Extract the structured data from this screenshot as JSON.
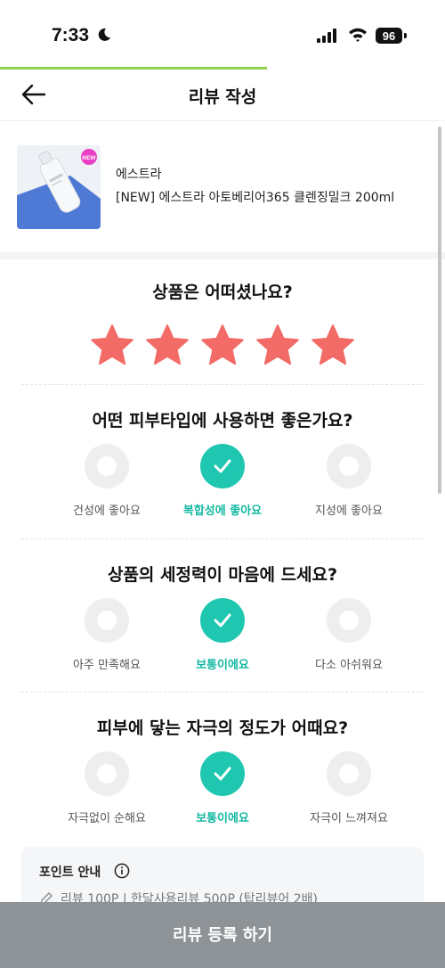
{
  "status_bar": {
    "time": "7:33",
    "battery": "96"
  },
  "progress": {
    "fraction": 0.6
  },
  "header": {
    "title": "리뷰 작성"
  },
  "product": {
    "brand": "에스트라",
    "name": "[NEW] 에스트라 아토베리어365 클렌징밀크 200ml",
    "badge": "NEW"
  },
  "rating": {
    "question": "상품은 어떠셨나요?",
    "stars": 5,
    "max_stars": 5,
    "star_color": "#f26b67"
  },
  "questions": [
    {
      "title": "어떤 피부타입에 사용하면 좋은가요?",
      "options": [
        "건성에 좋아요",
        "복합성에 좋아요",
        "지성에 좋아요"
      ],
      "selected": 1
    },
    {
      "title": "상품의 세정력이 마음에 드세요?",
      "options": [
        "아주 만족해요",
        "보통이에요",
        "다소 아쉬워요"
      ],
      "selected": 1
    },
    {
      "title": "피부에 닿는 자극의 정도가 어때요?",
      "options": [
        "자극없이 순해요",
        "보통이에요",
        "자극이 느껴져요"
      ],
      "selected": 1
    }
  ],
  "point_info": {
    "title": "포인트 안내",
    "text": "리뷰 100P | 한달사용리뷰 500P (탑리뷰어 2배)"
  },
  "submit": {
    "label": "리뷰 등록 하기"
  },
  "colors": {
    "accent": "#1fc7b0",
    "progress": "#8fd14f",
    "submit_bg": "#8e9398"
  }
}
